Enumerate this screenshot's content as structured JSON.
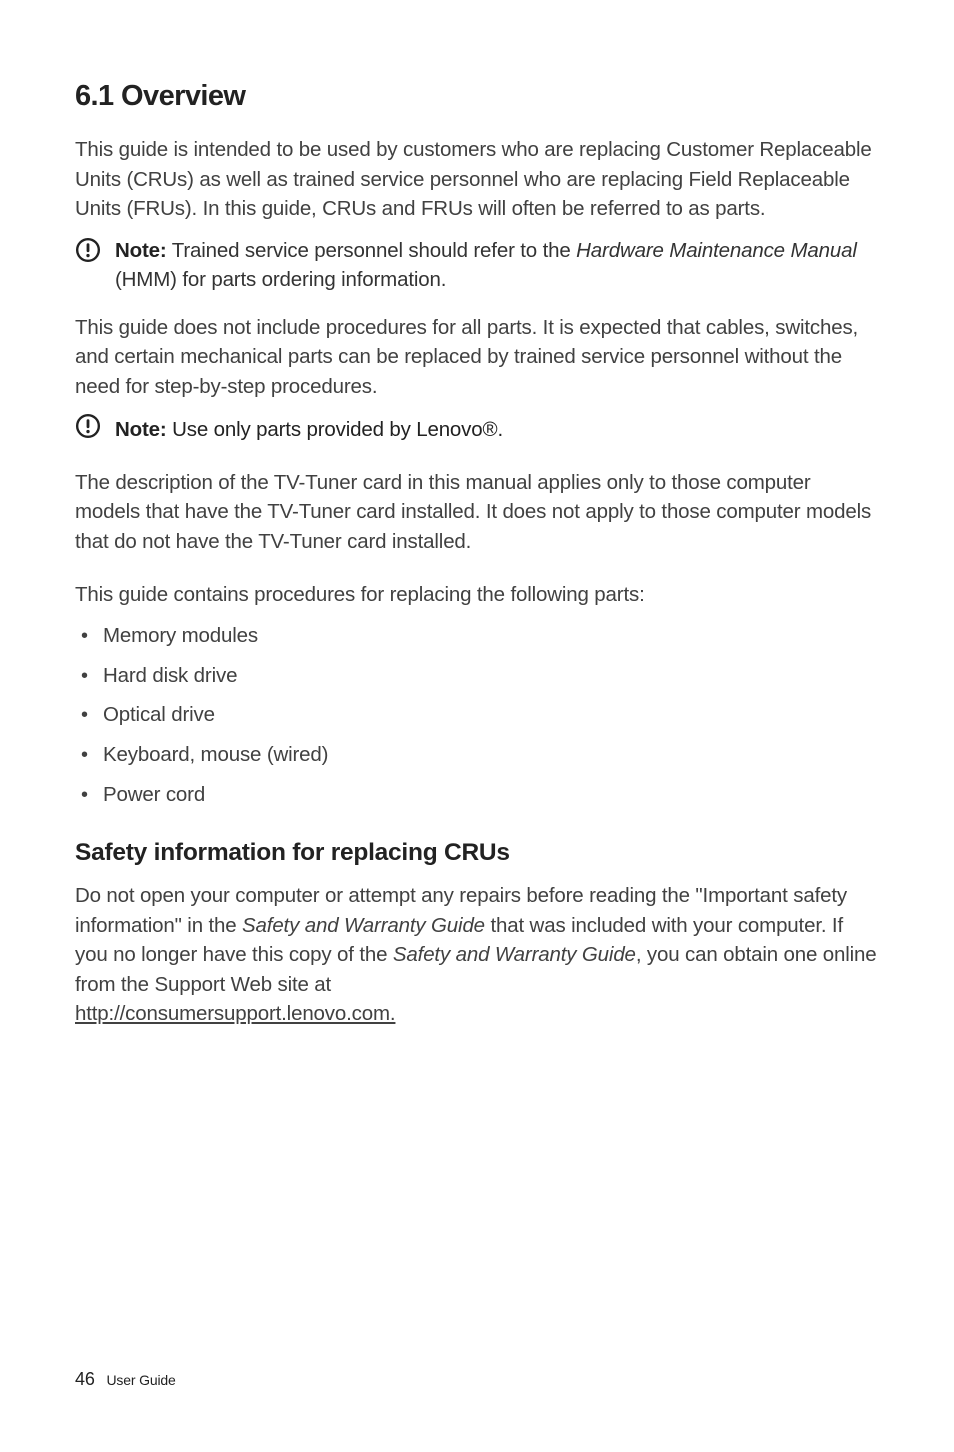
{
  "heading": "6.1 Overview",
  "para1": "This guide is intended to be used by customers who are replacing Customer Replaceable Units (CRUs) as well as trained service personnel who are replacing Field Replaceable Units (FRUs). In this guide, CRUs and FRUs will often be referred to as parts.",
  "note1": {
    "label": "Note:",
    "prefix": " Trained service personnel should refer to the ",
    "italic": "Hardware Maintenance Manual",
    "suffix": " (HMM) for parts ordering information."
  },
  "para2": "This guide does not include procedures for all parts. It is expected that cables, switches, and certain mechanical parts can be replaced by trained service personnel without the need for step-by-step procedures.",
  "note2": {
    "label": "Note:",
    "text": " Use only parts provided by Lenovo®."
  },
  "para3": "The description of the TV-Tuner card in this manual applies only to those computer models that have the TV-Tuner card installed. It does not apply to those computer models that do not have the TV-Tuner card installed.",
  "para4": "This guide contains procedures for replacing the following parts:",
  "bullets": [
    "Memory modules",
    "Hard disk drive",
    "Optical drive",
    "Keyboard, mouse (wired)",
    "Power cord"
  ],
  "subheading": "Safety information for replacing CRUs",
  "safety": {
    "part1": "Do not open your computer or attempt any repairs before reading the \"Important safety information\" in the ",
    "italic1": "Safety and Warranty Guide",
    "part2": " that was included with your computer. If you no longer have this copy of the ",
    "italic2": "Safety and Warranty Guide",
    "part3": ", you can obtain one online from the Support Web site at ",
    "link": "http://consumersupport.lenovo.com."
  },
  "footer": {
    "page": "46",
    "label": "User Guide"
  }
}
